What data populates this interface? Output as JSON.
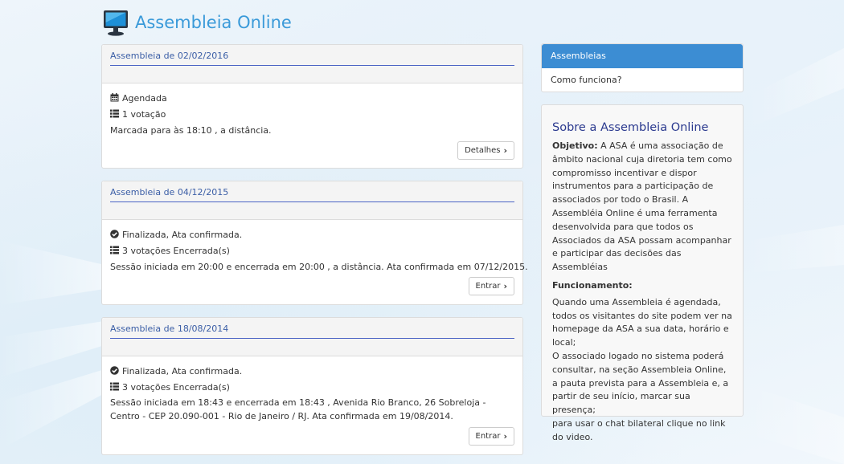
{
  "site": {
    "title": "Assembleia Online"
  },
  "assemblies": [
    {
      "title": "Assembleia de 02/02/2016",
      "status": "Agendada",
      "status_icon": "calendar-icon",
      "votes": "1 votação",
      "description": "Marcada para às 18:10 , a distância.",
      "button": "Detalhes"
    },
    {
      "title": "Assembleia de 04/12/2015",
      "status": "Finalizada, Ata confirmada.",
      "status_icon": "check-circle-icon",
      "votes": "3 votações Encerrada(s)",
      "description": "Sessão iniciada em 20:00 e encerrada em 20:00 , a distância. Ata confirmada em 07/12/2015.",
      "button": "Entrar"
    },
    {
      "title": "Assembleia de 18/08/2014",
      "status": "Finalizada, Ata confirmada.",
      "status_icon": "check-circle-icon",
      "votes": "3 votações Encerrada(s)",
      "description": "Sessão iniciada em 18:43 e encerrada em 18:43 , Avenida Rio Branco, 26 Sobreloja - Centro - CEP 20.090-001 - Rio de Janeiro / RJ. Ata confirmada em 19/08/2014.",
      "button": "Entrar"
    }
  ],
  "sidebar": {
    "nav": [
      {
        "label": "Assembleias",
        "active": true
      },
      {
        "label": "Como funciona?",
        "active": false
      }
    ],
    "about": {
      "heading": "Sobre a Assembleia Online",
      "objective_label": "Objetivo:",
      "objective_text": " A ASA é uma associação de âmbito nacional cuja diretoria tem como compromisso incentivar e dispor instrumentos para a participação de associados por todo o Brasil. A Assembléia Online é uma ferramenta desenvolvida para que todos os Associados da ASA possam acompanhar e participar das decisões das Assembléias",
      "functioning_label": "Funcionamento:",
      "functioning_lines": [
        "Quando uma Assembleia é agendada, todos os visitantes do site podem ver na homepage da ASA a sua data, horário e local;",
        "O associado logado no sistema poderá consultar, na seção Assembleia Online, a pauta prevista para a Assembleia e, a partir de seu início, marcar sua presença;",
        "para usar o chat bilateral clique no link do video."
      ]
    }
  },
  "colors": {
    "accent": "#3a9ad9",
    "nav_active": "#3c8dd3",
    "card_title": "#3b5ea6",
    "heading": "#2b3a8f"
  }
}
